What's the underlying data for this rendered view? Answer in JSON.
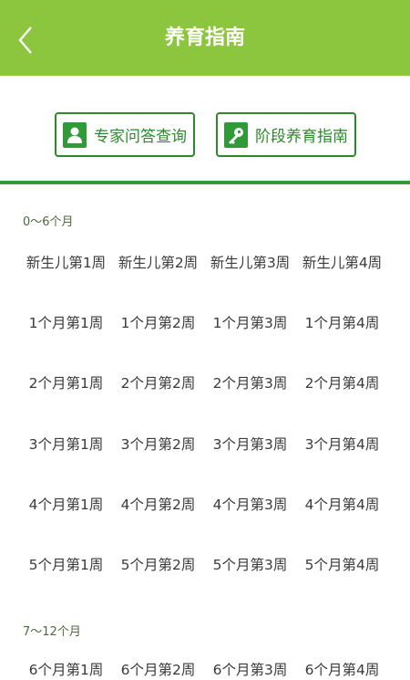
{
  "header": {
    "title": "养育指南"
  },
  "actions": {
    "expert_label": "专家问答查询",
    "guide_label": "阶段养育指南"
  },
  "sections": [
    {
      "label": "0～6个月",
      "rows": [
        [
          "新生儿第1周",
          "新生儿第2周",
          "新生儿第3周",
          "新生儿第4周"
        ],
        [
          "1个月第1周",
          "1个月第2周",
          "1个月第3周",
          "1个月第4周"
        ],
        [
          "2个月第1周",
          "2个月第2周",
          "2个月第3周",
          "2个月第4周"
        ],
        [
          "3个月第1周",
          "3个月第2周",
          "3个月第3周",
          "3个月第4周"
        ],
        [
          "4个月第1周",
          "4个月第2周",
          "4个月第3周",
          "4个月第4周"
        ],
        [
          "5个月第1周",
          "5个月第2周",
          "5个月第3周",
          "5个月第4周"
        ]
      ]
    },
    {
      "label": "7～12个月",
      "rows": [
        [
          "6个月第1周",
          "6个月第2周",
          "6个月第3周",
          "6个月第4周"
        ]
      ]
    }
  ],
  "colors": {
    "header_bg": "#8cc63e",
    "accent": "#2f9a37"
  }
}
